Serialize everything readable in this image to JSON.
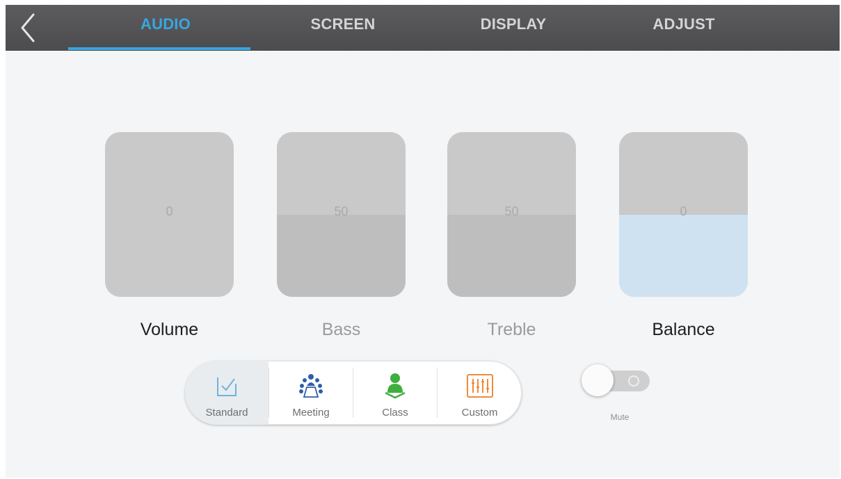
{
  "tabs": [
    {
      "label": "AUDIO",
      "active": true
    },
    {
      "label": "SCREEN",
      "active": false
    },
    {
      "label": "DISPLAY",
      "active": false
    },
    {
      "label": "ADJUST",
      "active": false
    }
  ],
  "back_icon": "chevron-left-icon",
  "colors": {
    "accent": "#3aa6df",
    "topbar": "#555557",
    "background": "#f4f5f6"
  },
  "controls": [
    {
      "label": "Volume",
      "value": "0",
      "level_percent": 0,
      "enabled": true
    },
    {
      "label": "Bass",
      "value": "50",
      "level_percent": 50,
      "enabled": false
    },
    {
      "label": "Treble",
      "value": "50",
      "level_percent": 50,
      "enabled": false
    },
    {
      "label": "Balance",
      "value": "0",
      "level_percent": 50,
      "enabled": true
    }
  ],
  "modes": [
    {
      "label": "Standard",
      "icon": "standard-check-icon",
      "selected": true
    },
    {
      "label": "Meeting",
      "icon": "meeting-people-icon",
      "selected": false
    },
    {
      "label": "Class",
      "icon": "class-reader-icon",
      "selected": false
    },
    {
      "label": "Custom",
      "icon": "equalizer-icon",
      "selected": false
    }
  ],
  "mute": {
    "label": "Mute",
    "on": false
  }
}
